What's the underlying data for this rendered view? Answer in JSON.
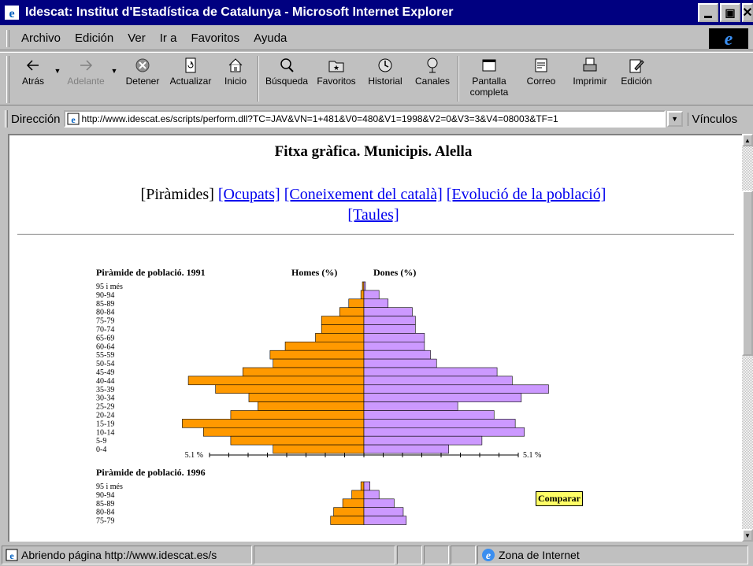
{
  "window": {
    "title": "Idescat: Institut d'Estadística de Catalunya - Microsoft Internet Explorer"
  },
  "menu": [
    "Archivo",
    "Edición",
    "Ver",
    "Ir a",
    "Favoritos",
    "Ayuda"
  ],
  "toolbar": {
    "back": "Atrás",
    "forward": "Adelante",
    "stop": "Detener",
    "refresh": "Actualizar",
    "home": "Inicio",
    "search": "Búsqueda",
    "favorites": "Favoritos",
    "history": "Historial",
    "channels": "Canales",
    "fullscreen_1": "Pantalla",
    "fullscreen_2": "completa",
    "mail": "Correo",
    "print": "Imprimir",
    "edit": "Edición"
  },
  "address": {
    "label": "Dirección",
    "url": "http://www.idescat.es/scripts/perform.dll?TC=JAV&VN=1+481&V0=480&V1=1998&V2=0&V3=3&V4=08003&TF=1",
    "links": "Vínculos"
  },
  "page": {
    "title": "Fitxa gràfica. Municipis. Alella",
    "nav_current": "[Piràmides]",
    "nav_links": [
      "[Ocupats]",
      "[Coneixement del català]",
      "[Evolució de la població]",
      "[Taules]"
    ],
    "compare_button": "Comparar"
  },
  "colors": {
    "men": "#ff9900",
    "women": "#cc99ff",
    "link": "#0000ee"
  },
  "chart_data": [
    {
      "type": "bar",
      "orientation": "population-pyramid",
      "title": "Piràmide de població. 1991",
      "left_label": "Homes (%)",
      "right_label": "Dones (%)",
      "scale_left": "5.1 %",
      "scale_right": "5.1 %",
      "xlim": [
        0,
        5.1
      ],
      "categories": [
        "95 i més",
        "90-94",
        "85-89",
        "80-84",
        "75-79",
        "70-74",
        "65-69",
        "60-64",
        "55-59",
        "50-54",
        "45-49",
        "40-44",
        "35-39",
        "30-34",
        "25-29",
        "20-24",
        "15-19",
        "10-14",
        "5-9",
        "0-4"
      ],
      "series": [
        {
          "name": "Homes (%)",
          "values": [
            0.05,
            0.1,
            0.5,
            0.8,
            1.4,
            1.4,
            1.6,
            2.6,
            3.1,
            3.0,
            4.0,
            5.8,
            4.9,
            3.8,
            3.5,
            4.4,
            6.0,
            5.3,
            4.4,
            3.0
          ]
        },
        {
          "name": "Dones (%)",
          "values": [
            0.05,
            0.5,
            0.8,
            1.6,
            1.7,
            1.7,
            2.0,
            2.0,
            2.2,
            2.4,
            4.4,
            4.9,
            6.1,
            5.2,
            3.1,
            4.3,
            5.0,
            5.3,
            3.9,
            2.8
          ]
        }
      ]
    },
    {
      "type": "bar",
      "orientation": "population-pyramid",
      "title": "Piràmide de població. 1996",
      "categories": [
        "95 i més",
        "90-94",
        "85-89",
        "80-84",
        "75-79"
      ],
      "series": [
        {
          "name": "Homes (%)",
          "values": [
            0.1,
            0.4,
            0.7,
            1.0,
            1.1
          ]
        },
        {
          "name": "Dones (%)",
          "values": [
            0.2,
            0.5,
            1.0,
            1.3,
            1.4
          ]
        }
      ]
    }
  ],
  "status": {
    "text": "Abriendo página http://www.idescat.es/s",
    "zone": "Zona de Internet"
  }
}
